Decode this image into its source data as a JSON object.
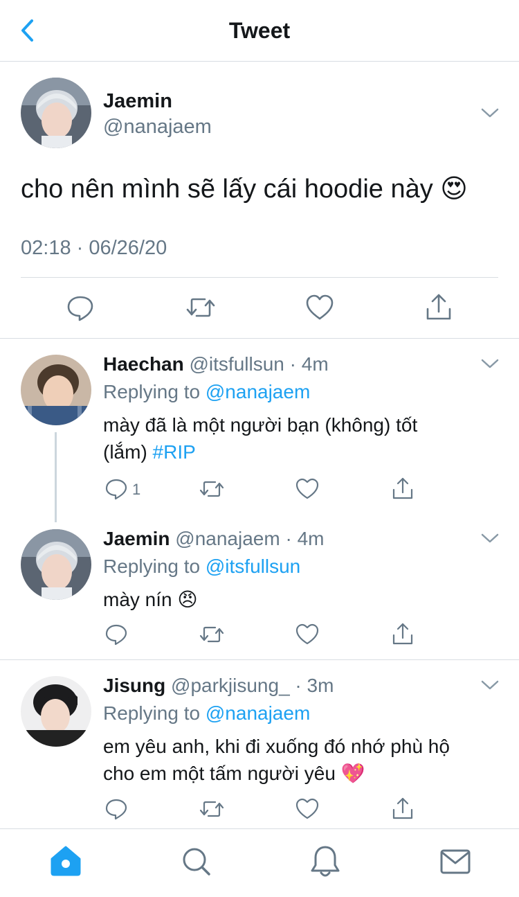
{
  "header": {
    "title": "Tweet",
    "back_icon": "chevron-left-icon"
  },
  "main_tweet": {
    "name": "Jaemin",
    "handle": "@nanajaem",
    "text": "cho nên mình sẽ lấy cái hoodie này 😍",
    "timestamp": "02:18 · 06/26/20"
  },
  "replies": [
    {
      "name": "Haechan",
      "handle": "@itsfullsun",
      "time": "· 4m",
      "replying_prefix": "Replying to",
      "replying_to": "@nanajaem",
      "text_line1": "mày đã là một người bạn (không) tốt",
      "text_line2": "(lắm)",
      "hashtag": "#RIP",
      "reply_count": "1"
    },
    {
      "name": "Jaemin",
      "handle": "@nanajaem",
      "time": "· 4m",
      "replying_prefix": "Replying to",
      "replying_to": "@itsfullsun",
      "text_line1": "mày nín 😠"
    },
    {
      "name": "Jisung",
      "handle": "@parkjisung_",
      "time": "· 3m",
      "replying_prefix": "Replying to",
      "replying_to": "@nanajaem",
      "text_line1": "em yêu anh, khi đi xuống đó nhớ phù hộ",
      "text_line2": "cho em một tấm người yêu 💖"
    }
  ],
  "tabbar": {
    "items": [
      "home-icon",
      "search-icon",
      "notifications-icon",
      "messages-icon"
    ]
  },
  "colors": {
    "accent": "#1da1f2",
    "muted": "#657786",
    "text": "#14171a",
    "divider": "#d8dde2"
  }
}
